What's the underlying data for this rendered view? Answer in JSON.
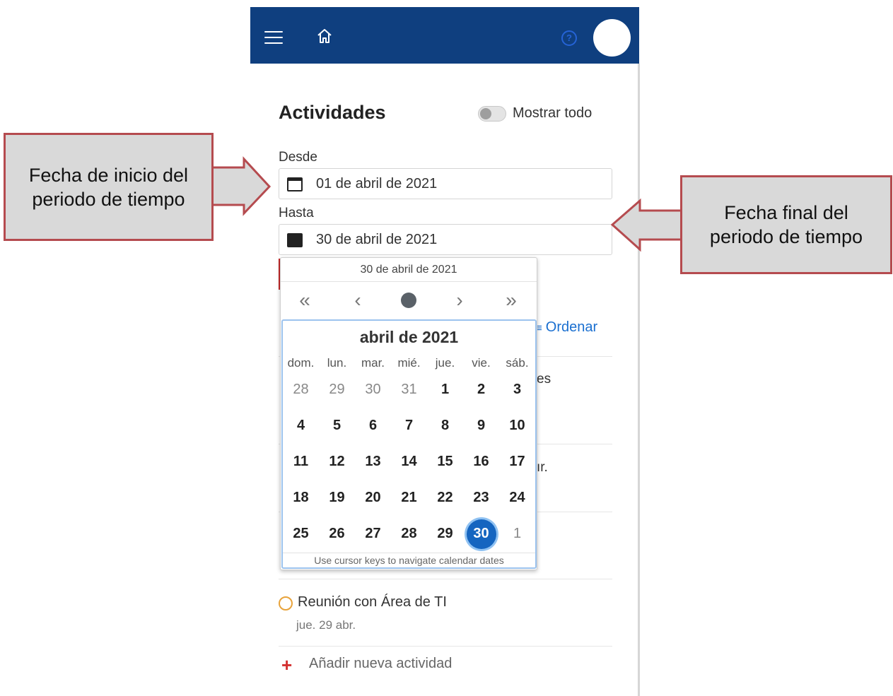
{
  "app": {
    "title": "Actividades",
    "help_icon": "?",
    "show_all_label": "Mostrar todo",
    "show_all_on": false
  },
  "filters": {
    "desde_label": "Desde",
    "desde_value": "01 de abril de 2021",
    "hasta_label": "Hasta",
    "hasta_value": "30 de abril de 2021"
  },
  "datepicker": {
    "header": "30 de abril de 2021",
    "nav": [
      "«",
      "‹",
      "›",
      "»"
    ],
    "month_title": "abril de 2021",
    "weekdays": [
      "dom.",
      "lun.",
      "mar.",
      "mié.",
      "jue.",
      "vie.",
      "sáb."
    ],
    "weeks": [
      [
        {
          "d": "28",
          "m": true
        },
        {
          "d": "29",
          "m": true
        },
        {
          "d": "30",
          "m": true
        },
        {
          "d": "31",
          "m": true
        },
        {
          "d": "1"
        },
        {
          "d": "2"
        },
        {
          "d": "3"
        }
      ],
      [
        {
          "d": "4"
        },
        {
          "d": "5"
        },
        {
          "d": "6"
        },
        {
          "d": "7"
        },
        {
          "d": "8"
        },
        {
          "d": "9"
        },
        {
          "d": "10"
        }
      ],
      [
        {
          "d": "11"
        },
        {
          "d": "12"
        },
        {
          "d": "13"
        },
        {
          "d": "14"
        },
        {
          "d": "15"
        },
        {
          "d": "16"
        },
        {
          "d": "17"
        }
      ],
      [
        {
          "d": "18"
        },
        {
          "d": "19"
        },
        {
          "d": "20"
        },
        {
          "d": "21"
        },
        {
          "d": "22"
        },
        {
          "d": "23"
        },
        {
          "d": "24"
        }
      ],
      [
        {
          "d": "25"
        },
        {
          "d": "26"
        },
        {
          "d": "27"
        },
        {
          "d": "28"
        },
        {
          "d": "29"
        },
        {
          "d": "30",
          "sel": true
        },
        {
          "d": "1",
          "m": true
        }
      ]
    ],
    "hint": "Use cursor keys to navigate calendar dates"
  },
  "list": {
    "sort_label": "Ordenar",
    "peek_1": "es",
    "peek_2": "ır.",
    "activity": {
      "title": "Reunión con Área de TI",
      "date": "jue. 29 abr."
    },
    "add_label": "Añadir nueva actividad"
  },
  "annotations": {
    "left": [
      "Fecha de inicio del",
      "periodo de tiempo"
    ],
    "right": [
      "Fecha final del",
      "periodo de tiempo"
    ]
  },
  "colors": {
    "topbar": "#0f3f7f",
    "accent": "#1565c0",
    "callout_border": "#b54b4f",
    "callout_fill": "#d9d9d9"
  }
}
